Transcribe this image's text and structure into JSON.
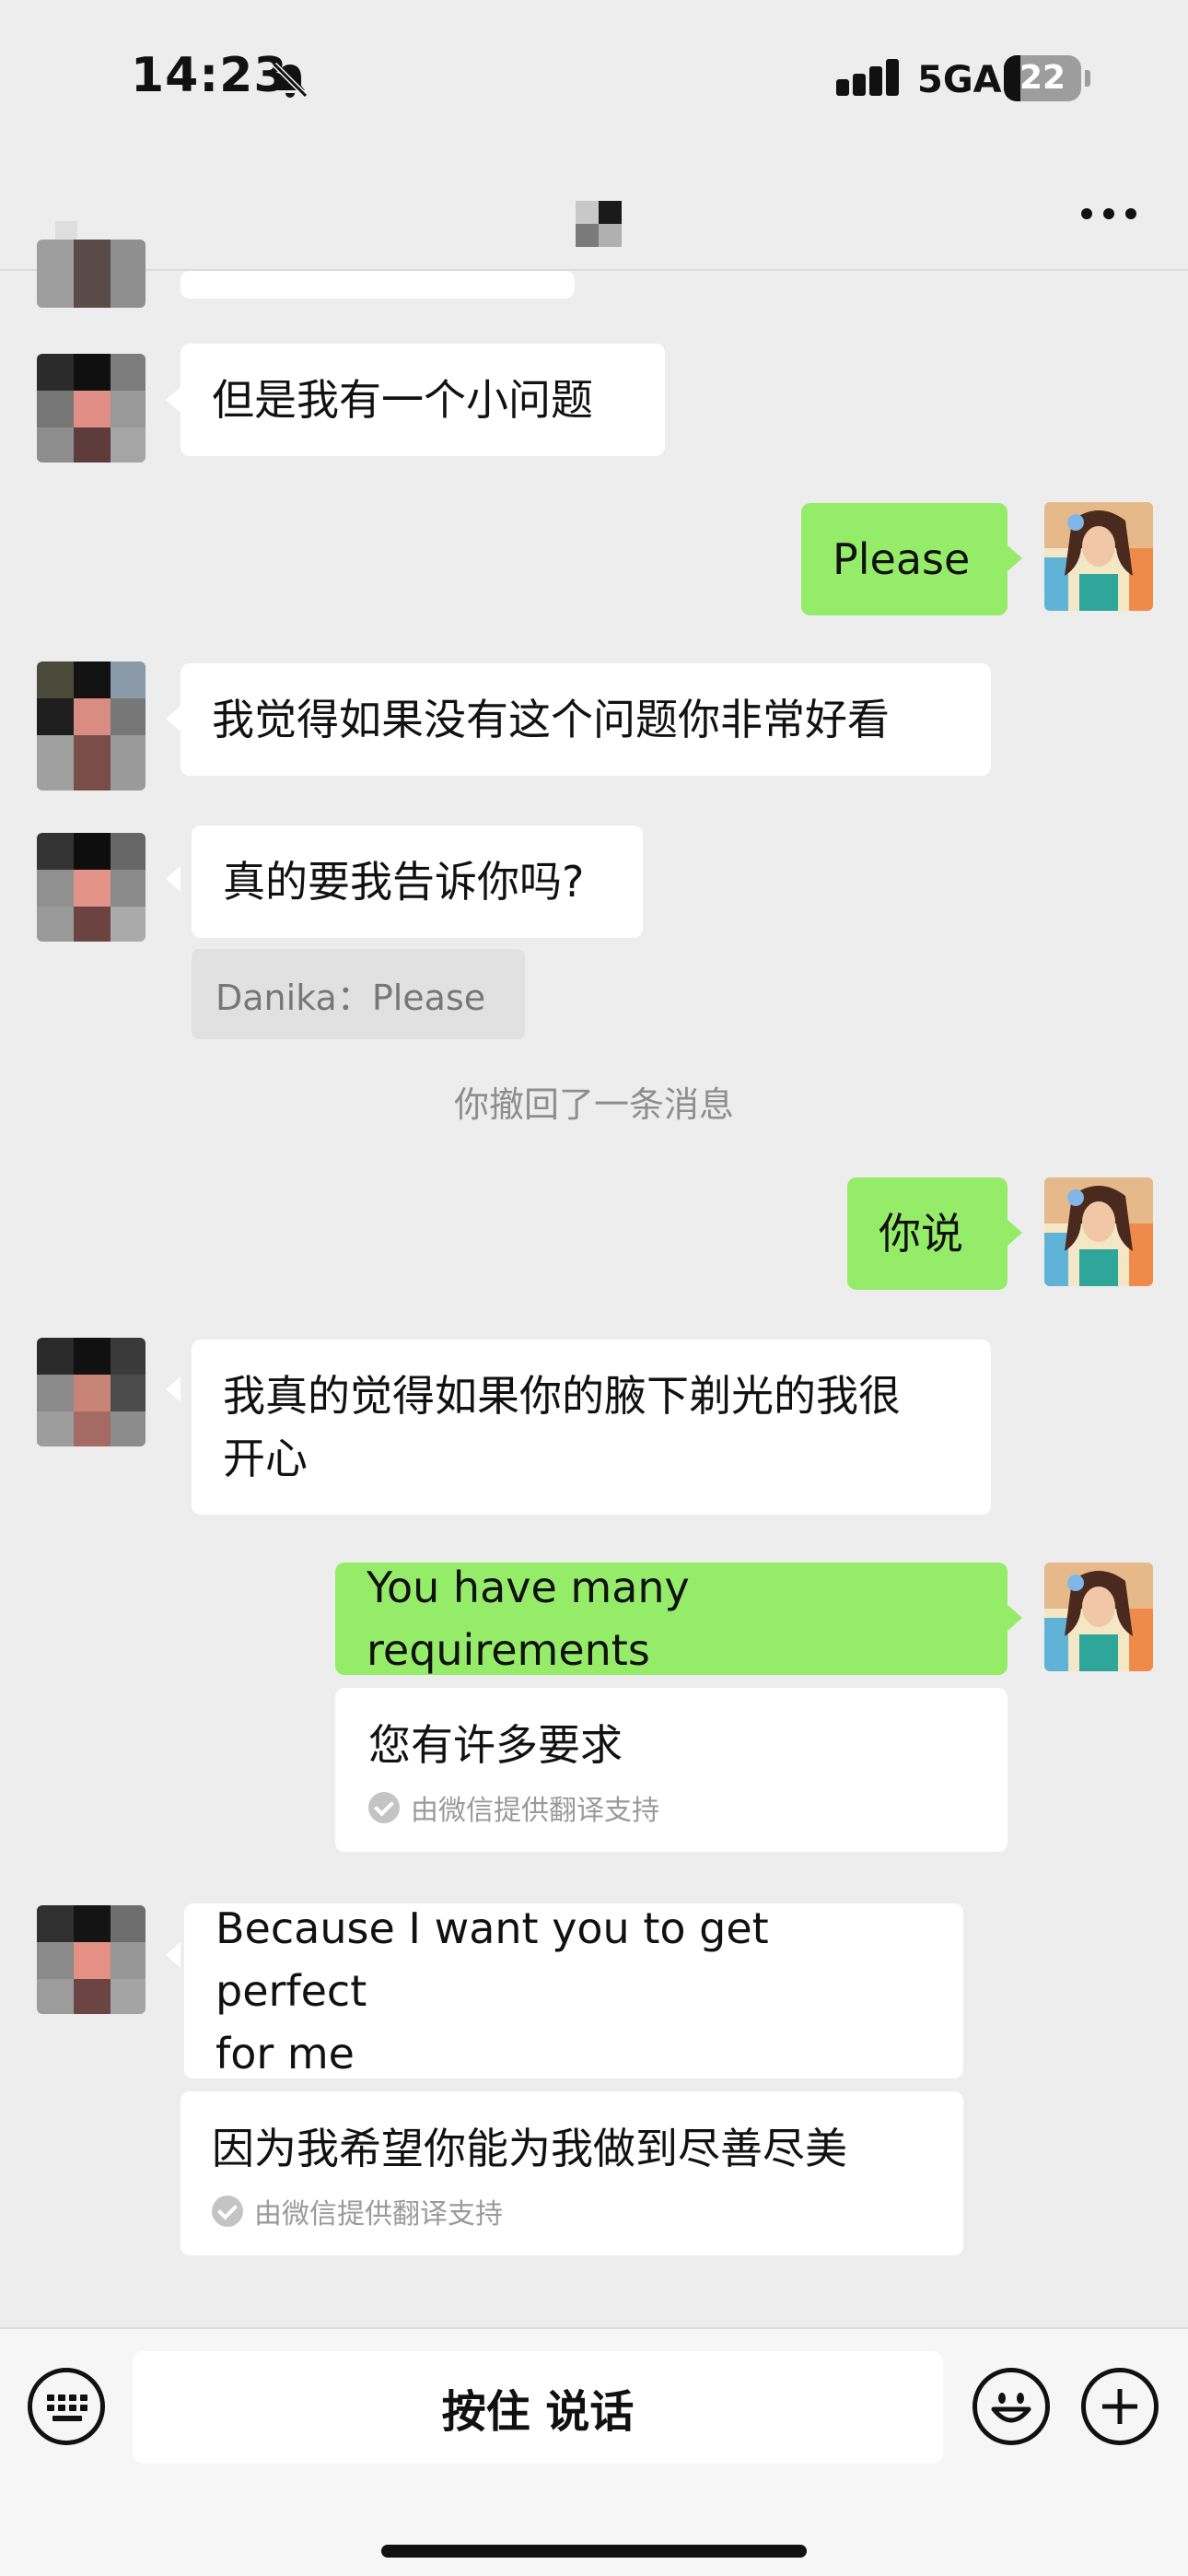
{
  "status_bar": {
    "time": "14:23",
    "network": "5GA",
    "battery": "22",
    "battery_level": 0.22,
    "icons": [
      "bell-off-icon",
      "signal-icon",
      "battery-icon"
    ]
  },
  "header": {
    "more_icon": "more-icon"
  },
  "messages": [
    {
      "side": "left",
      "text": "但是我有一个小问题"
    },
    {
      "side": "right",
      "text": "Please"
    },
    {
      "side": "left",
      "text": "我觉得如果没有这个问题你非常好看"
    },
    {
      "side": "left",
      "text": "真的要我告诉你吗?",
      "quote": "Danika：Please"
    },
    {
      "side": "system",
      "text": "你撤回了一条消息"
    },
    {
      "side": "right",
      "text": "你说"
    },
    {
      "side": "left",
      "text_lines": [
        "我真的觉得如果你的腋下剃光的我很",
        "开心"
      ]
    },
    {
      "side": "right",
      "text": "You have many requirements",
      "translation": "您有许多要求",
      "translation_note": "由微信提供翻译支持"
    },
    {
      "side": "left",
      "text_lines": [
        "Because I want you to get perfect",
        "for me"
      ],
      "translation": "因为我希望你能为我做到尽善尽美",
      "translation_note": "由微信提供翻译支持"
    }
  ],
  "input_bar": {
    "voice_label": "按住 说话",
    "icons": [
      "keyboard-icon",
      "emoji-icon",
      "plus-icon"
    ]
  },
  "colors": {
    "background": "#ededed",
    "my_bubble": "#95ec69",
    "their_bubble": "#ffffff"
  }
}
